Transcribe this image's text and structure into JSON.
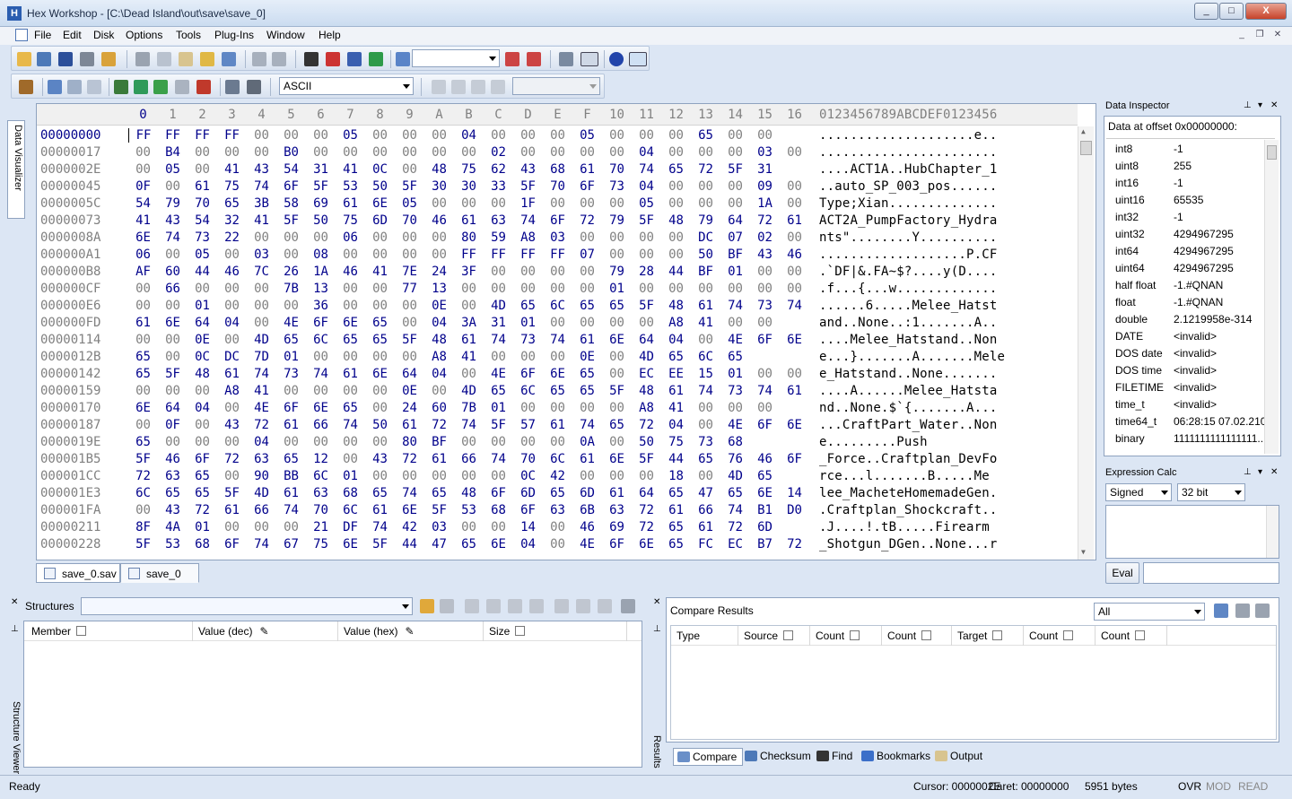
{
  "window": {
    "title": "Hex Workshop - [C:\\Dead Island\\out\\save\\save_0]",
    "min": "_",
    "max": "□",
    "close": "X"
  },
  "menu": [
    "File",
    "Edit",
    "Disk",
    "Options",
    "Tools",
    "Plug-Ins",
    "Window",
    "Help"
  ],
  "toolbar": {
    "encoding": "ASCII",
    "goto_value": "",
    "record_value": ""
  },
  "hex": {
    "columns": [
      "0",
      "1",
      "2",
      "3",
      "4",
      "5",
      "6",
      "7",
      "8",
      "9",
      "A",
      "B",
      "C",
      "D",
      "E",
      "F",
      "10",
      "11",
      "12",
      "13",
      "14",
      "15",
      "16"
    ],
    "ascii_header": "0123456789ABCDEF0123456",
    "rows": [
      {
        "o": "00000000",
        "b": "FF FF FF FF 00 00 00 05 00 00 00 04 00 00 00 05 00 00 00 65 00 00",
        "a": "....................e.."
      },
      {
        "o": "00000017",
        "b": "00 B4 00 00 00 B0 00 00 00 00 00 00 02 00 00 00 00 04 00 00 00 03 00",
        "a": "......................."
      },
      {
        "o": "0000002E",
        "b": "00 05 00 41 43 54 31 41 0C 00 48 75 62 43 68 61 70 74 65 72 5F 31",
        "a": "....ACT1A..HubChapter_1"
      },
      {
        "o": "00000045",
        "b": "0F 00 61 75 74 6F 5F 53 50 5F 30 30 33 5F 70 6F 73 04 00 00 00 09 00",
        "a": "..auto_SP_003_pos......"
      },
      {
        "o": "0000005C",
        "b": "54 79 70 65 3B 58 69 61 6E 05 00 00 00 1F 00 00 00 05 00 00 00 1A 00",
        "a": "Type;Xian.............."
      },
      {
        "o": "00000073",
        "b": "41 43 54 32 41 5F 50 75 6D 70 46 61 63 74 6F 72 79 5F 48 79 64 72 61",
        "a": "ACT2A_PumpFactory_Hydra"
      },
      {
        "o": "0000008A",
        "b": "6E 74 73 22 00 00 00 06 00 00 00 80 59 A8 03 00 00 00 00 DC 07 02 00",
        "a": "nts\"........Y.........."
      },
      {
        "o": "000000A1",
        "b": "06 00 05 00 03 00 08 00 00 00 00 FF FF FF FF 07 00 00 00 50 BF 43 46",
        "a": "...................P.CF"
      },
      {
        "o": "000000B8",
        "b": "AF 60 44 46 7C 26 1A 46 41 7E 24 3F 00 00 00 00 79 28 44 BF 01 00 00",
        "a": ".`DF|&.FA~$?....y(D...."
      },
      {
        "o": "000000CF",
        "b": "00 66 00 00 00 7B 13 00 00 77 13 00 00 00 00 00 01 00 00 00 00 00 00",
        "a": ".f...{...w............."
      },
      {
        "o": "000000E6",
        "b": "00 00 01 00 00 00 36 00 00 00 0E 00 4D 65 6C 65 65 5F 48 61 74 73 74",
        "a": "......6.....Melee_Hatst"
      },
      {
        "o": "000000FD",
        "b": "61 6E 64 04 00 4E 6F 6E 65 00 04 3A 31 01 00 00 00 00 A8 41 00 00",
        "a": "and..None..:1.......A.."
      },
      {
        "o": "00000114",
        "b": "00 00 0E 00 4D 65 6C 65 65 5F 48 61 74 73 74 61 6E 64 04 00 4E 6F 6E",
        "a": "....Melee_Hatstand..Non"
      },
      {
        "o": "0000012B",
        "b": "65 00 0C DC 7D 01 00 00 00 00 A8 41 00 00 00 0E 00 4D 65 6C 65",
        "a": "e...}.......A.......Mele"
      },
      {
        "o": "00000142",
        "b": "65 5F 48 61 74 73 74 61 6E 64 04 00 4E 6F 6E 65 00 EC EE 15 01 00 00",
        "a": "e_Hatstand..None......."
      },
      {
        "o": "00000159",
        "b": "00 00 00 A8 41 00 00 00 00 0E 00 4D 65 6C 65 65 5F 48 61 74 73 74 61",
        "a": "....A......Melee_Hatsta"
      },
      {
        "o": "00000170",
        "b": "6E 64 04 00 4E 6F 6E 65 00 24 60 7B 01 00 00 00 00 A8 41 00 00 00",
        "a": "nd..None.$`{.......A..."
      },
      {
        "o": "00000187",
        "b": "00 0F 00 43 72 61 66 74 50 61 72 74 5F 57 61 74 65 72 04 00 4E 6F 6E",
        "a": "...CraftPart_Water..Non"
      },
      {
        "o": "0000019E",
        "b": "65 00 00 00 04 00 00 00 00 80 BF 00 00 00 00 0A 00 50 75 73 68",
        "a": "e.........Push"
      },
      {
        "o": "000001B5",
        "b": "5F 46 6F 72 63 65 12 00 43 72 61 66 74 70 6C 61 6E 5F 44 65 76 46 6F",
        "a": "_Force..Craftplan_DevFo"
      },
      {
        "o": "000001CC",
        "b": "72 63 65 00 90 BB 6C 01 00 00 00 00 00 0C 42 00 00 00 18 00 4D 65",
        "a": "rce...l.......B.....Me"
      },
      {
        "o": "000001E3",
        "b": "6C 65 65 5F 4D 61 63 68 65 74 65 48 6F 6D 65 6D 61 64 65 47 65 6E 14",
        "a": "lee_MacheteHomemadeGen."
      },
      {
        "o": "000001FA",
        "b": "00 43 72 61 66 74 70 6C 61 6E 5F 53 68 6F 63 6B 63 72 61 66 74 B1 D0",
        "a": ".Craftplan_Shockcraft.."
      },
      {
        "o": "00000211",
        "b": "8F 4A 01 00 00 00 21 DF 74 42 03 00 00 14 00 46 69 72 65 61 72 6D",
        "a": ".J....!.tB.....Firearm"
      },
      {
        "o": "00000228",
        "b": "5F 53 68 6F 74 67 75 6E 5F 44 47 65 6E 04 00 4E 6F 6E 65 FC EC B7 72",
        "a": "_Shotgun_DGen..None...r"
      }
    ]
  },
  "file_tabs": [
    "save_0.sav",
    "save_0"
  ],
  "side_tabs": {
    "left": "Data Visualizer",
    "structure": "Structure Viewer",
    "results": "Results"
  },
  "inspector": {
    "title": "Data Inspector",
    "offset_label": "Data at offset 0x00000000:",
    "items": [
      {
        "k": "int8",
        "v": "-1"
      },
      {
        "k": "uint8",
        "v": "255"
      },
      {
        "k": "int16",
        "v": "-1"
      },
      {
        "k": "uint16",
        "v": "65535"
      },
      {
        "k": "int32",
        "v": "-1"
      },
      {
        "k": "uint32",
        "v": "4294967295"
      },
      {
        "k": "int64",
        "v": "4294967295"
      },
      {
        "k": "uint64",
        "v": "4294967295"
      },
      {
        "k": "half float",
        "v": "-1.#QNAN"
      },
      {
        "k": "float",
        "v": "-1.#QNAN"
      },
      {
        "k": "double",
        "v": "2.1219958e-314"
      },
      {
        "k": "DATE",
        "v": "<invalid>"
      },
      {
        "k": "DOS date",
        "v": "<invalid>"
      },
      {
        "k": "DOS time",
        "v": "<invalid>"
      },
      {
        "k": "FILETIME",
        "v": "<invalid>"
      },
      {
        "k": "time_t",
        "v": "<invalid>"
      },
      {
        "k": "time64_t",
        "v": "06:28:15 07.02.2106"
      },
      {
        "k": "binary",
        "v": "1111111111111111..."
      }
    ]
  },
  "expression": {
    "title": "Expression Calc",
    "sign": "Signed",
    "bits": "32 bit",
    "eval": "Eval"
  },
  "structures": {
    "label": "Structures",
    "columns": [
      "Member",
      "Value (dec)",
      "Value (hex)",
      "Size"
    ]
  },
  "compare": {
    "title": "Compare Results",
    "filter": "All",
    "columns": [
      "Type",
      "Source",
      "Count",
      "Count",
      "Target",
      "Count",
      "Count"
    ]
  },
  "bottom_tabs": [
    "Compare",
    "Checksum",
    "Find",
    "Bookmarks",
    "Output"
  ],
  "status": {
    "ready": "Ready",
    "cursor": "Cursor: 0000002E",
    "caret": "Caret: 00000000",
    "size": "5951 bytes",
    "ovr": "OVR",
    "mod": "MOD",
    "read": "READ"
  },
  "colors": {
    "hex_blue": "#00008b",
    "offset_gray": "#808080",
    "chrome": "#dce6f4"
  }
}
